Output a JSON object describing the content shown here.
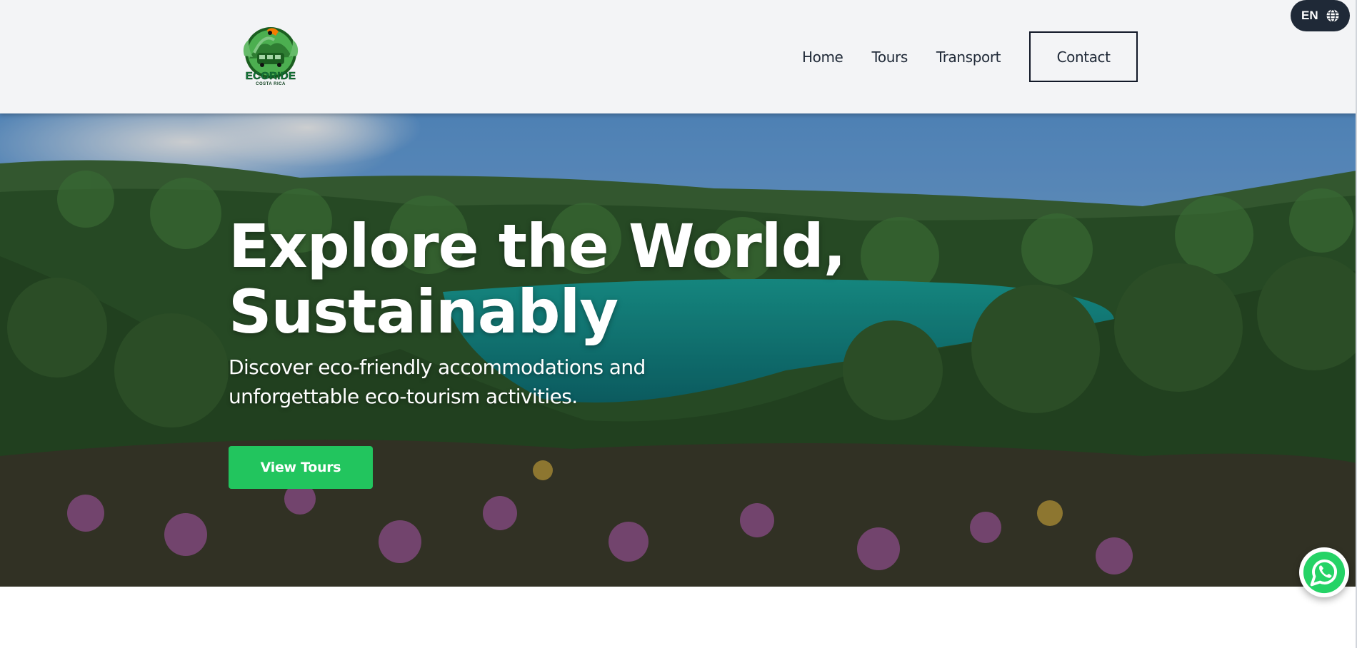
{
  "header": {
    "logo": {
      "name": "ECORIDE",
      "tagline": "COSTA RICA"
    },
    "nav": {
      "home_label": "Home",
      "tours_label": "Tours",
      "transport_label": "Transport",
      "contact_label": "Contact"
    },
    "language": {
      "code": "EN",
      "icon": "globe-icon"
    }
  },
  "hero": {
    "title_line1": "Explore the World,",
    "title_line2": "Sustainably",
    "subtitle_line1": "Discover eco-friendly accommodations and",
    "subtitle_line2": "unforgettable eco-tourism activities.",
    "cta_label": "View Tours",
    "background": "crater-lake-rainforest-photo"
  },
  "floating": {
    "chat_icon": "whatsapp-icon"
  },
  "colors": {
    "header_bg": "#f3f4f6",
    "cta_green": "#22c55e",
    "dark": "#1f2937",
    "whatsapp_green": "#25d366"
  }
}
